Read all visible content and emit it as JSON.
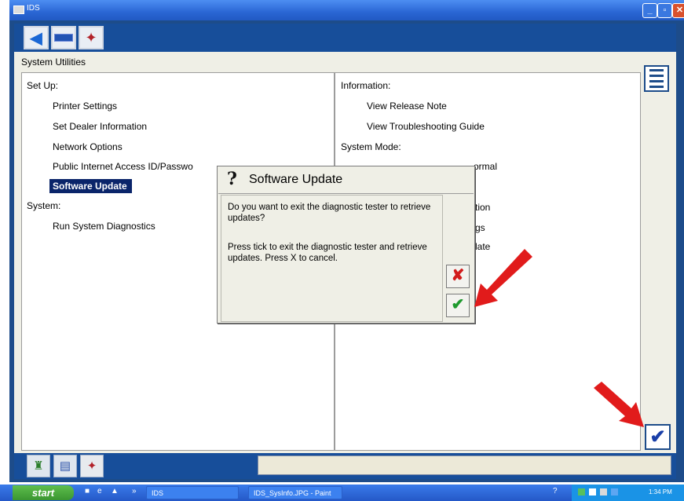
{
  "window": {
    "title": "IDS"
  },
  "panel_heading": "System Utilities",
  "left_panel": {
    "setup_heading": "Set Up:",
    "setup_items": [
      "Printer Settings",
      "Set Dealer Information",
      "Network Options",
      "Public Internet Access ID/Passwo",
      "Software Update"
    ],
    "selected_item": "Software Update",
    "system_heading": "System:",
    "system_items": [
      "Run System Diagnostics"
    ]
  },
  "right_panel": {
    "info_heading": "Information:",
    "info_items": [
      "View Release Note",
      "View Troubleshooting Guide"
    ],
    "mode_heading": "System Mode:",
    "partial_items": [
      "ormal",
      "tion",
      "gs",
      "late"
    ]
  },
  "dialog": {
    "icon": "?",
    "title": "Software Update",
    "message1": "Do you want to exit the diagnostic tester to retrieve updates?",
    "message2": "Press tick to exit the diagnostic tester and retrieve updates.  Press X to cancel.",
    "cancel_icon": "✘",
    "confirm_icon": "✔"
  },
  "icons": {
    "back": "back-arrow-icon",
    "list": "list-icon",
    "confirm": "checkmark-icon"
  },
  "colors": {
    "selection": "#0a246a",
    "arrow": "#e11b1b",
    "frame": "#1d4c8a"
  },
  "taskbar": {
    "start_label": "start",
    "tasks": [
      "IDS",
      "IDS_SysInfo.JPG - Paint"
    ],
    "clock": "1:34 PM"
  }
}
